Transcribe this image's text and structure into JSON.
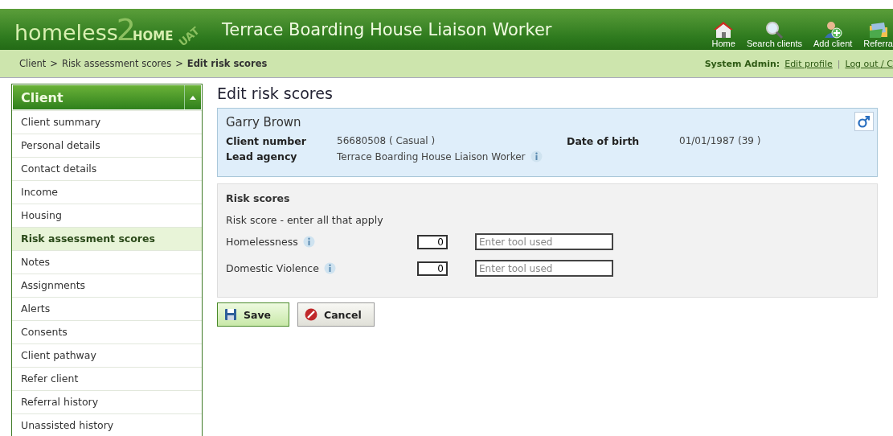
{
  "header": {
    "logo": {
      "word": "homeless",
      "digit": "2",
      "home": "HOME",
      "env": "UAT"
    },
    "title": "Terrace Boarding House Liaison Worker",
    "nav": [
      {
        "kind": "home",
        "label": "Home"
      },
      {
        "kind": "search",
        "label": "Search clients"
      },
      {
        "kind": "add",
        "label": "Add client"
      },
      {
        "kind": "referral",
        "label": "Referra"
      }
    ]
  },
  "breadcrumb": {
    "items": [
      "Client",
      "Risk assessment scores",
      "Edit risk scores"
    ],
    "separator": ">",
    "user": "System Admin:",
    "links": [
      "Edit profile",
      "Log out / C"
    ],
    "link_separator": "|"
  },
  "sidebar": {
    "title": "Client",
    "items": [
      {
        "label": "Client summary",
        "selected": false
      },
      {
        "label": "Personal details",
        "selected": false
      },
      {
        "label": "Contact details",
        "selected": false
      },
      {
        "label": "Income",
        "selected": false
      },
      {
        "label": "Housing",
        "selected": false
      },
      {
        "label": "Risk assessment scores",
        "selected": true
      },
      {
        "label": "Notes",
        "selected": false
      },
      {
        "label": "Assignments",
        "selected": false
      },
      {
        "label": "Alerts",
        "selected": false
      },
      {
        "label": "Consents",
        "selected": false
      },
      {
        "label": "Client pathway",
        "selected": false
      },
      {
        "label": "Refer client",
        "selected": false
      },
      {
        "label": "Referral history",
        "selected": false
      },
      {
        "label": "Unassisted history",
        "selected": false
      }
    ]
  },
  "page_title": "Edit risk scores",
  "client": {
    "name": "Garry Brown",
    "client_number_label": "Client number",
    "client_number": "56680508 ( Casual )",
    "dob_label": "Date of birth",
    "dob": "01/01/1987 (39 )",
    "lead_agency_label": "Lead agency",
    "lead_agency": "Terrace Boarding House Liaison Worker"
  },
  "risk": {
    "title": "Risk scores",
    "hint": "Risk score - enter all that apply",
    "rows": [
      {
        "label": "Homelessness",
        "score": "0",
        "placeholder": "Enter tool used"
      },
      {
        "label": "Domestic Violence",
        "score": "0",
        "placeholder": "Enter tool used"
      }
    ]
  },
  "buttons": [
    {
      "kind": "save",
      "label": "Save"
    },
    {
      "kind": "cancel",
      "label": "Cancel"
    }
  ]
}
